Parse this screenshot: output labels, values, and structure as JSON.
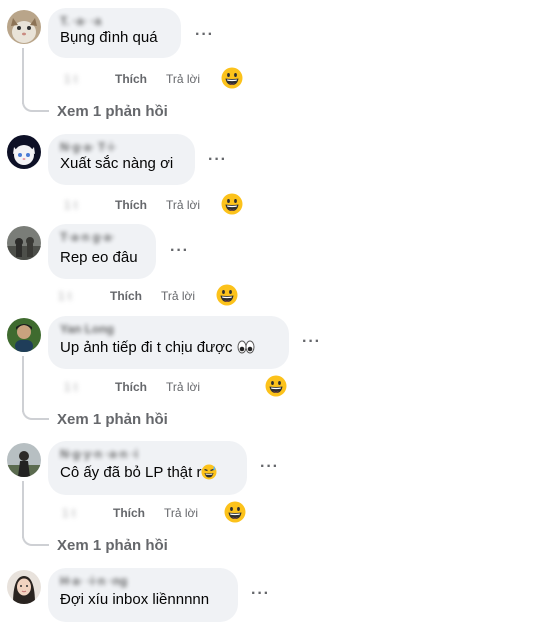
{
  "ui": {
    "like_label": "Thích",
    "reply_label": "Trả lời",
    "more_label": "···",
    "view_replies_label": "Xem 1 phản hồi"
  },
  "comments": [
    {
      "author": "T. ·a· ·a",
      "time": "1 t",
      "text": "Bụng đình quá"
    },
    {
      "author": "N·g·a· T·i·",
      "time": "1 t",
      "text": "Xuất sắc nàng ơi"
    },
    {
      "author": "T·a·n g·a·",
      "time": "1 t",
      "text": "Rep eo đâu"
    },
    {
      "author": "Yan Long",
      "time": "1 t",
      "text": "Up ảnh tiếp đi t chịu được"
    },
    {
      "author": "N·g·y·n ·a·n ·i",
      "time": "1 t",
      "text": "Cô ấy đã bỏ LP thật r"
    },
    {
      "author": "H·a· ·i·n ·ng",
      "time": "1 t",
      "text": "Đợi xíu inbox liềnnnnn"
    }
  ],
  "icons": {
    "more": "more-options-icon",
    "reaction": "grinning-face-emoji-icon",
    "eyes": "eyes-emoji-icon",
    "sweat": "grinning-sweat-emoji-icon"
  },
  "colors": {
    "bubble": "#f0f2f5",
    "secondary_text": "#65676b",
    "thread_line": "#ced0d4",
    "emoji_yellow": "#fcc21b"
  }
}
